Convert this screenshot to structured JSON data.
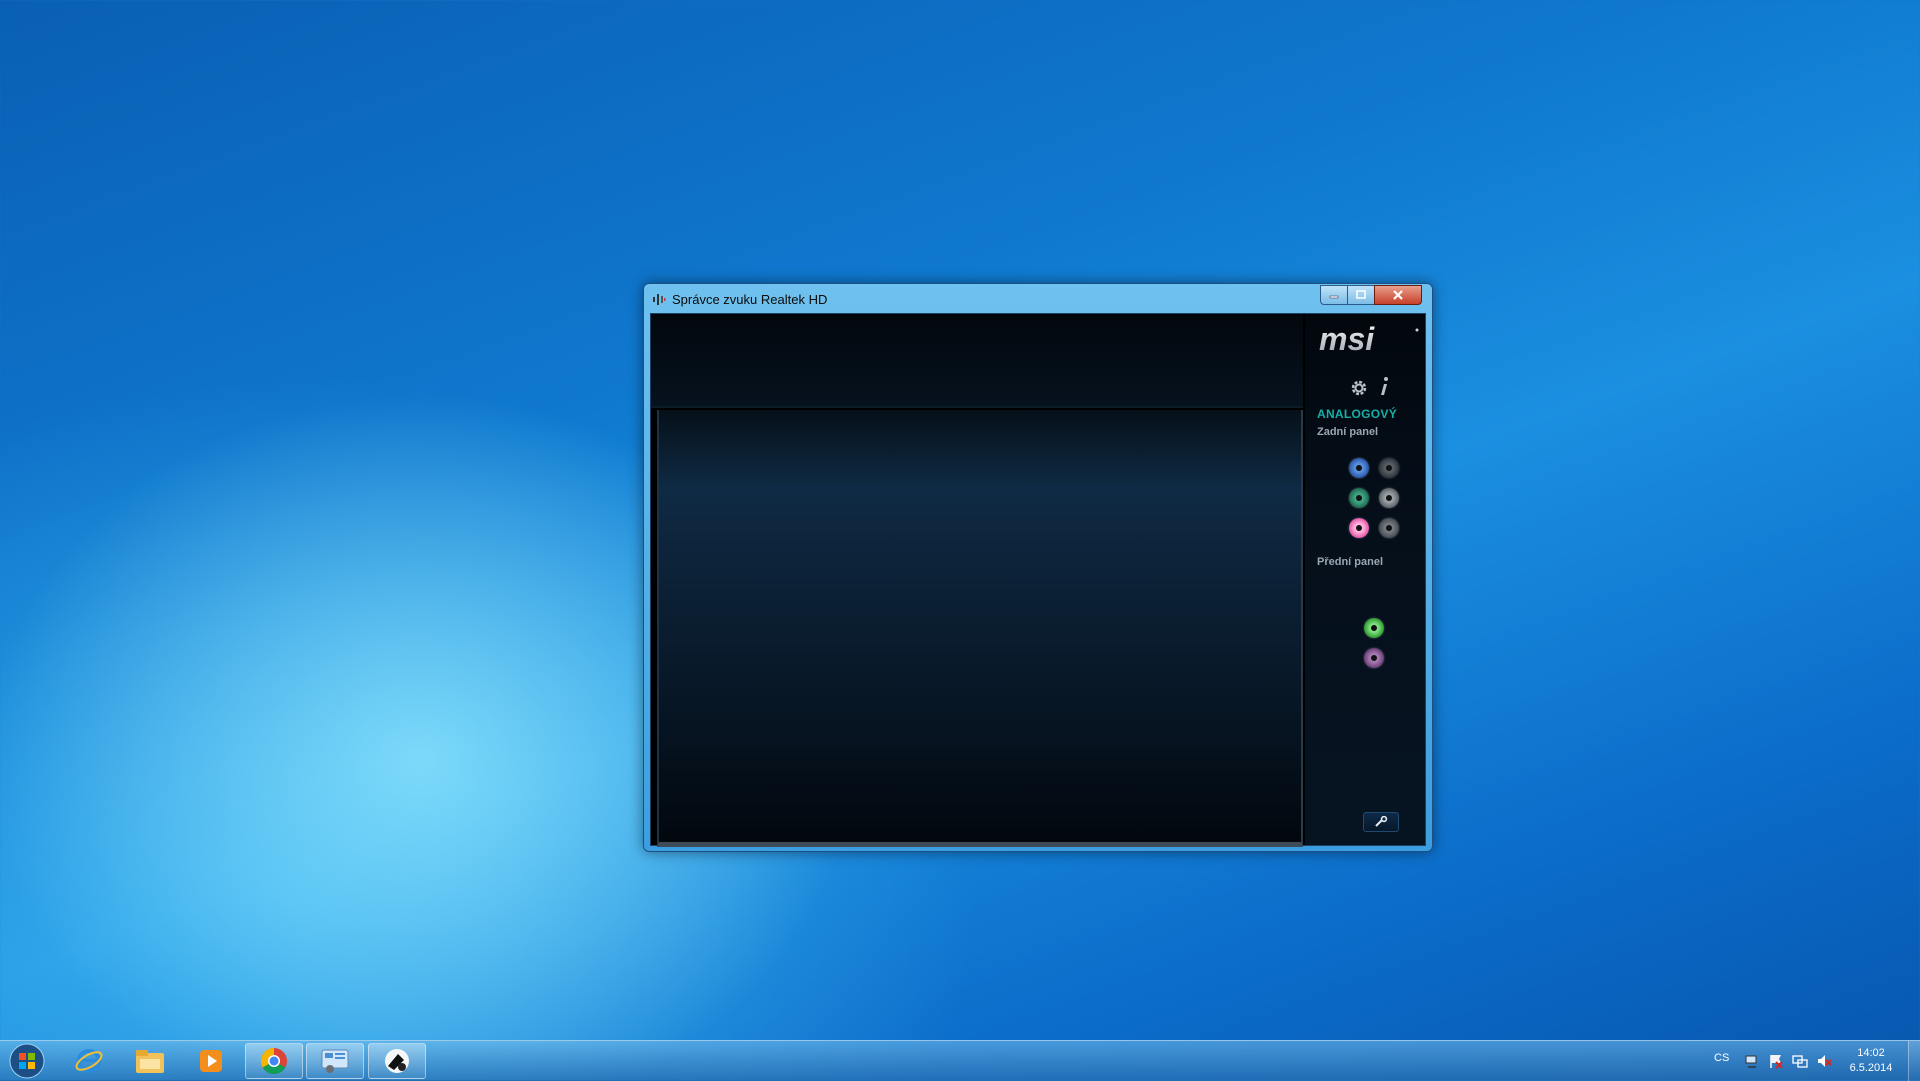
{
  "window": {
    "title": "Správce zvuku Realtek HD",
    "min_label": "minimize",
    "max_label": "maximize",
    "close_label": "close"
  },
  "panel": {
    "brand": "msi",
    "section_title": "ANALOGOVÝ",
    "rear_label": "Zadní panel",
    "front_label": "Přední panel",
    "rear_jacks": [
      {
        "color": "#3a6fc9",
        "state": "available"
      },
      {
        "color": "#4a4f55",
        "state": "available"
      },
      {
        "color": "#2f8f6a",
        "state": "available"
      },
      {
        "color": "#7a7f84",
        "state": "available"
      },
      {
        "color": "#f06fb4",
        "state": "plugged"
      },
      {
        "color": "#5f6468",
        "state": "available"
      }
    ],
    "front_jacks": [
      {
        "color": "#3aba3a",
        "state": "plugged"
      },
      {
        "color": "#8a5a93",
        "state": "available"
      }
    ]
  },
  "taskbar": {
    "pinned": [
      "start-orb-icon",
      "internet-explorer-icon",
      "file-explorer-icon",
      "media-player-icon",
      "chrome-icon",
      "control-panel-icon",
      "realtek-speaker-icon"
    ],
    "language": "CS",
    "time": "14:02",
    "date": "6.5.2014"
  }
}
